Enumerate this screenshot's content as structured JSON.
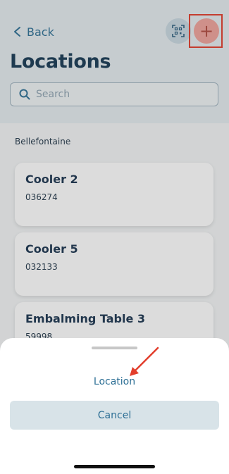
{
  "header": {
    "back_label": "Back",
    "title": "Locations",
    "scan_icon": "qr-scan-icon",
    "add_icon": "plus-icon",
    "add_symbol": "+"
  },
  "search": {
    "placeholder": "Search"
  },
  "group": {
    "label": "Bellefontaine"
  },
  "locations": [
    {
      "name": "Cooler 2",
      "code": "036274"
    },
    {
      "name": "Cooler 5",
      "code": "032133"
    },
    {
      "name": "Embalming Table 3",
      "code": "59998"
    }
  ],
  "sheet": {
    "option_label": "Location",
    "cancel_label": "Cancel"
  },
  "colors": {
    "accent": "#2d6f95",
    "highlight": "#e23e2c",
    "title": "#183a55"
  }
}
